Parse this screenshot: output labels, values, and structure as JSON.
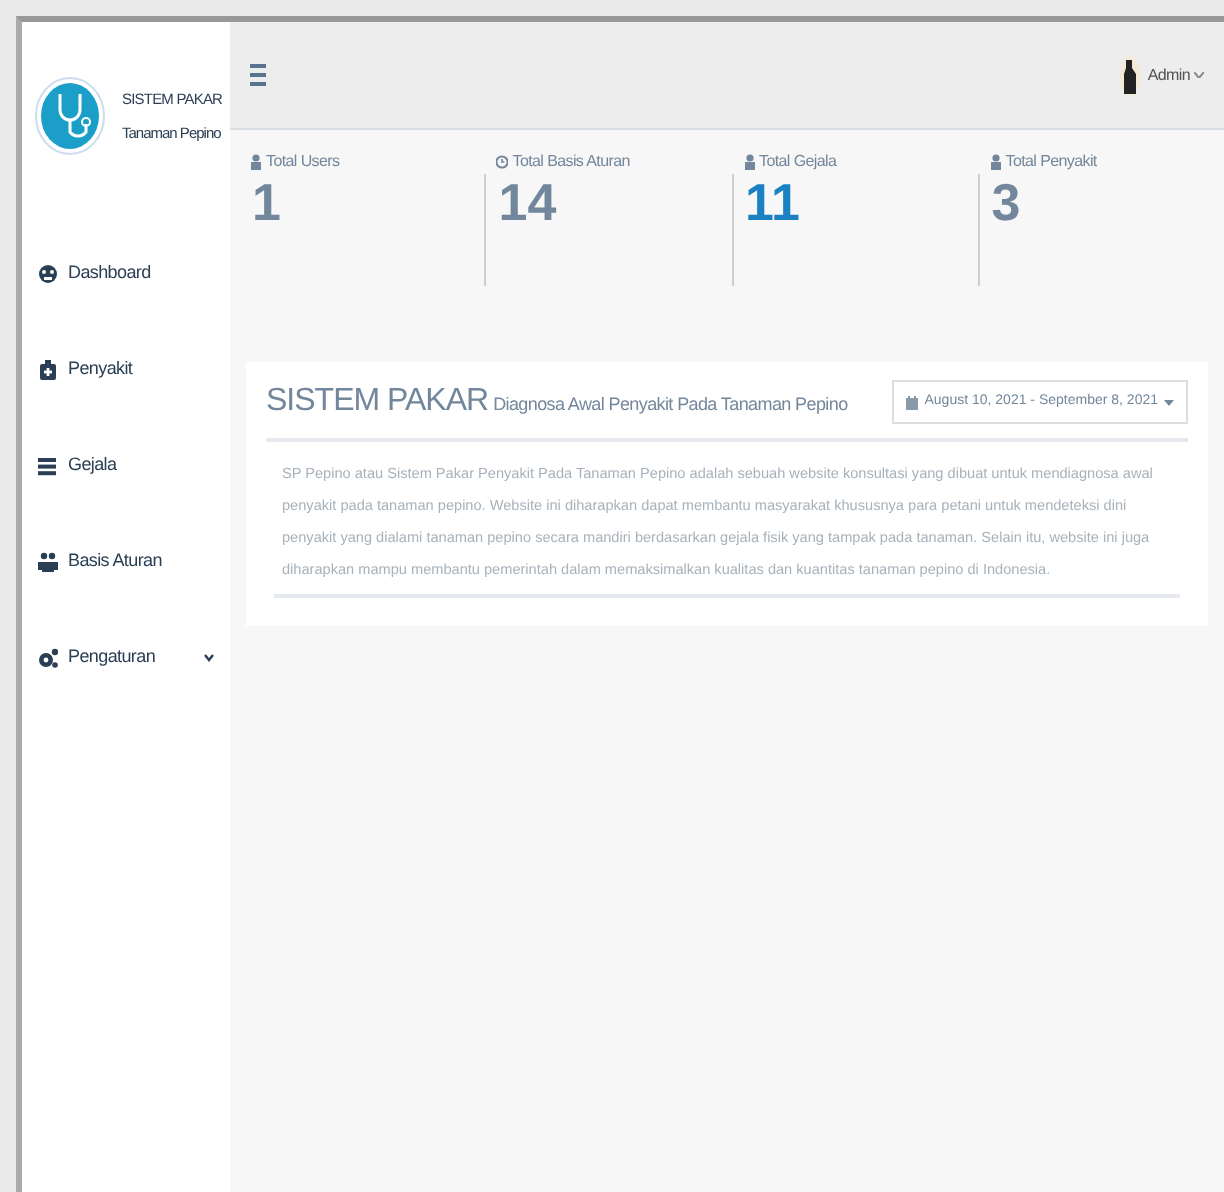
{
  "brand": {
    "title": "SISTEM PAKAR",
    "subtitle": "Tanaman Pepino"
  },
  "sidebar": {
    "items": [
      {
        "label": "Dashboard",
        "expandable": false
      },
      {
        "label": "Penyakit",
        "expandable": false
      },
      {
        "label": "Gejala",
        "expandable": false
      },
      {
        "label": "Basis Aturan",
        "expandable": false
      },
      {
        "label": "Pengaturan",
        "expandable": true
      }
    ]
  },
  "topbar": {
    "user": "Admin"
  },
  "stats": [
    {
      "label": "Total Users",
      "value": "1",
      "color": "#73879c"
    },
    {
      "label": "Total Basis Aturan",
      "value": "14",
      "color": "#73879c"
    },
    {
      "label": "Total Gejala",
      "value": "11",
      "color": "#1a82c3"
    },
    {
      "label": "Total Penyakit",
      "value": "3",
      "color": "#73879c"
    }
  ],
  "panel": {
    "title": "SISTEM PAKAR",
    "subtitle": "Diagnosa Awal Penyakit Pada Tanaman Pepino",
    "date_range": "August 10, 2021 - September 8, 2021",
    "text": "SP Pepino atau Sistem Pakar Penyakit Pada Tanaman Pepino adalah sebuah website konsultasi yang dibuat untuk mendiagnosa awal penyakit pada tanaman pepino. Website ini diharapkan dapat membantu masyarakat khususnya para petani untuk mendeteksi dini penyakit yang dialami tanaman pepino secara mandiri berdasarkan gejala fisik yang tampak pada tanaman. Selain itu, website ini juga diharapkan mampu membantu pemerintah dalam memaksimalkan kualitas dan kuantitas tanaman pepino di Indonesia."
  }
}
